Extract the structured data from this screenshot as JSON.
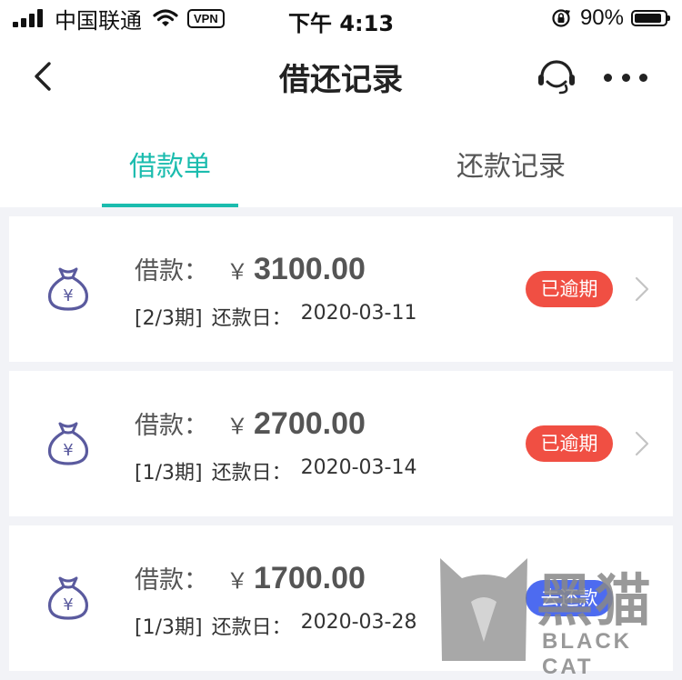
{
  "status_bar": {
    "carrier": "中国联通",
    "vpn": "VPN",
    "time": "下午 4:13",
    "battery": "90%",
    "battery_level": 0.9
  },
  "nav": {
    "title": "借还记录",
    "back_icon": "chevron-left-icon",
    "service_icon": "customer-service-icon",
    "more_icon": "more-dots-icon"
  },
  "tabs": [
    {
      "label": "借款单",
      "active": true
    },
    {
      "label": "还款记录",
      "active": false
    }
  ],
  "colors": {
    "accent": "#1bbcae",
    "overdue": "#f04f43",
    "repay": "#4d6bf0",
    "icon": "#5a5a9e"
  },
  "loans": [
    {
      "label": "借款：",
      "currency": "￥",
      "amount": "3100.00",
      "period": "[2/3期]",
      "due_label": "还款日：",
      "due_date": "2020-03-11",
      "status": "已逾期"
    },
    {
      "label": "借款：",
      "currency": "￥",
      "amount": "2700.00",
      "period": "[1/3期]",
      "due_label": "还款日：",
      "due_date": "2020-03-14",
      "status": "已逾期"
    },
    {
      "label": "借款：",
      "currency": "￥",
      "amount": "1700.00",
      "period": "[1/3期]",
      "due_label": "还款日：",
      "due_date": "2020-03-28",
      "status": "去还款"
    }
  ],
  "watermark": {
    "cn": "黑猫",
    "en": "BLACK CAT"
  }
}
